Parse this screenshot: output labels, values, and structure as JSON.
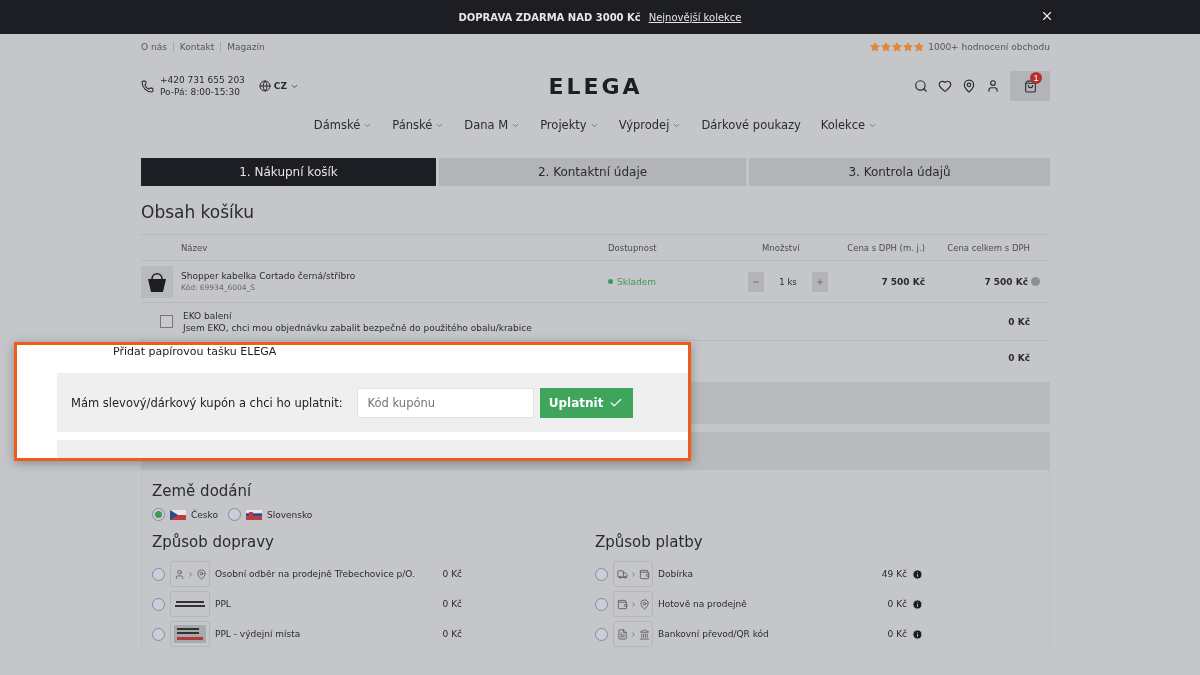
{
  "promo_bar": {
    "text": "DOPRAVA ZDARMA NAD 3000 Kč",
    "link": "Nejnovější kolekce"
  },
  "top_links": [
    "O nás",
    "Kontakt",
    "Magazín"
  ],
  "rating": {
    "stars": 5,
    "text": "1000+ hodnocení obchodu"
  },
  "header": {
    "phone": "+420 731 655 203",
    "hours": "Po-Pá: 8:00-15:30",
    "language": "CZ",
    "logo": "ELEGA",
    "cart_count": "1"
  },
  "nav": [
    {
      "label": "Dámské",
      "has_menu": true
    },
    {
      "label": "Pánské",
      "has_menu": true
    },
    {
      "label": "Dana M",
      "has_menu": true
    },
    {
      "label": "Projekty",
      "has_menu": true
    },
    {
      "label": "Výprodej",
      "has_menu": true
    },
    {
      "label": "Dárkové poukazy",
      "has_menu": false
    },
    {
      "label": "Kolekce",
      "has_menu": true
    }
  ],
  "steps": [
    {
      "label": "1. Nákupní košík",
      "selected": true
    },
    {
      "label": "2. Kontaktní údaje",
      "selected": false
    },
    {
      "label": "3. Kontrola údajů",
      "selected": false
    }
  ],
  "cart": {
    "title": "Obsah košíku",
    "columns": [
      "Název",
      "Dostupnost",
      "Množství",
      "Cena s DPH (m. j.)",
      "Cena celkem s DPH"
    ],
    "items": [
      {
        "name": "Shopper kabelka Cortado černá/stříbro",
        "code": "Kód: 69934_6004_S",
        "availability": "Skladem",
        "in_stock": true,
        "quantity": "1 ks",
        "unit_price": "7 500 Kč",
        "total": "7 500 Kč"
      }
    ],
    "extras": [
      {
        "kind": "checkbox",
        "title": "EKO balení",
        "description": "Jsem EKO, chci mou objednávku zabalit bezpečně do použitého obalu/krabice",
        "price": "0 Kč",
        "checked": false
      },
      {
        "kind": "plain",
        "title": "Přidat papírovou tašku ELEGA",
        "price": "0 Kč"
      }
    ]
  },
  "coupon": {
    "label": "Mám slevový/dárkový kupón a chci ho uplatnit:",
    "placeholder": "Kód kupónu",
    "button": "Uplatnit"
  },
  "delivery_country": {
    "title": "Země dodání",
    "options": [
      {
        "label": "Česko",
        "selected": true
      },
      {
        "label": "Slovensko",
        "selected": false
      }
    ]
  },
  "shipping": {
    "title": "Způsob dopravy",
    "options": [
      {
        "label": "Osobní odběr na prodejně Třebechovice p/O.",
        "price": "0 Kč",
        "kind": "pickup",
        "selected": false
      },
      {
        "label": "PPL",
        "price": "0 Kč",
        "kind": "courier",
        "selected": false
      },
      {
        "label": "PPL - výdejní místa",
        "price": "0 Kč",
        "kind": "parcelshop",
        "selected": false
      }
    ]
  },
  "payment": {
    "title": "Způsob platby",
    "options": [
      {
        "label": "Dobírka",
        "price": "49 Kč",
        "kind": "cod",
        "selected": false
      },
      {
        "label": "Hotově na prodejně",
        "price": "0 Kč",
        "kind": "cash",
        "selected": false
      },
      {
        "label": "Bankovní převod/QR kód",
        "price": "0 Kč",
        "kind": "transfer",
        "selected": false
      }
    ]
  }
}
